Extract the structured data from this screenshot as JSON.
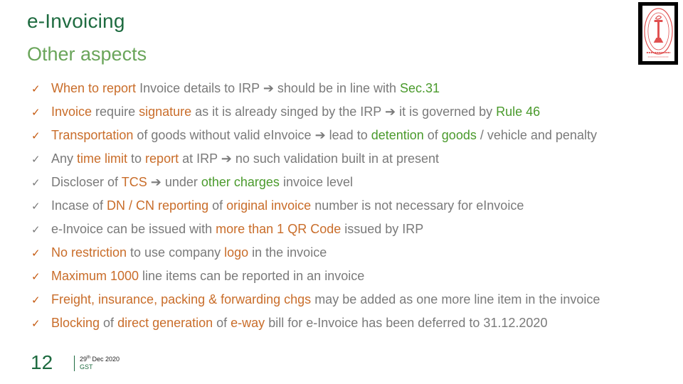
{
  "header": {
    "title": "e-Invoicing",
    "subtitle": "Other aspects"
  },
  "logo": {
    "icon": "institute-emblem-icon",
    "color": "#e05050"
  },
  "colors": {
    "title": "#1e6b40",
    "subtitle": "#6aa55a",
    "body_text": "#7a7a7a",
    "highlight_orange": "#c96d2a",
    "highlight_green": "#4a9a2c"
  },
  "bullets": [
    {
      "check": "o",
      "segments": [
        {
          "t": "When to report",
          "c": "o"
        },
        {
          "t": " Invoice details to IRP ",
          "c": "n"
        },
        {
          "t": "➔",
          "c": "n"
        },
        {
          "t": " should be in line with ",
          "c": "n"
        },
        {
          "t": "Sec.31",
          "c": "g"
        }
      ]
    },
    {
      "check": "o",
      "segments": [
        {
          "t": "Invoice",
          "c": "o"
        },
        {
          "t": " require ",
          "c": "n"
        },
        {
          "t": "signature",
          "c": "o"
        },
        {
          "t": " as it is already singed by the IRP ",
          "c": "n"
        },
        {
          "t": "➔",
          "c": "n"
        },
        {
          "t": " it is governed by ",
          "c": "n"
        },
        {
          "t": "Rule 46",
          "c": "g"
        }
      ]
    },
    {
      "check": "o",
      "segments": [
        {
          "t": "Transportation",
          "c": "o"
        },
        {
          "t": " of goods without valid eInvoice ",
          "c": "n"
        },
        {
          "t": "➔",
          "c": "n"
        },
        {
          "t": " lead to ",
          "c": "n"
        },
        {
          "t": "detention",
          "c": "g"
        },
        {
          "t": " of ",
          "c": "n"
        },
        {
          "t": "goods",
          "c": "g"
        },
        {
          "t": " / vehicle and penalty",
          "c": "n"
        }
      ]
    },
    {
      "check": "g",
      "segments": [
        {
          "t": "Any ",
          "c": "n"
        },
        {
          "t": "time limit",
          "c": "o"
        },
        {
          "t": " to ",
          "c": "n"
        },
        {
          "t": "report",
          "c": "o"
        },
        {
          "t": " at IRP ",
          "c": "n"
        },
        {
          "t": "➔",
          "c": "n"
        },
        {
          "t": " no such validation built in at present",
          "c": "n"
        }
      ]
    },
    {
      "check": "g",
      "segments": [
        {
          "t": "Discloser of ",
          "c": "n"
        },
        {
          "t": "TCS",
          "c": "o"
        },
        {
          "t": " ",
          "c": "n"
        },
        {
          "t": "➔",
          "c": "n"
        },
        {
          "t": " under ",
          "c": "n"
        },
        {
          "t": "other charges",
          "c": "g"
        },
        {
          "t": " invoice level",
          "c": "n"
        }
      ]
    },
    {
      "check": "g",
      "segments": [
        {
          "t": "Incase of ",
          "c": "n"
        },
        {
          "t": "DN / CN reporting",
          "c": "o"
        },
        {
          "t": " of ",
          "c": "n"
        },
        {
          "t": "original invoice",
          "c": "o"
        },
        {
          "t": " number is not necessary for eInvoice",
          "c": "n"
        }
      ]
    },
    {
      "check": "g",
      "segments": [
        {
          "t": "e-Invoice can be issued with ",
          "c": "n"
        },
        {
          "t": "more than 1 QR Code",
          "c": "o"
        },
        {
          "t": " issued by IRP",
          "c": "n"
        }
      ]
    },
    {
      "check": "o",
      "segments": [
        {
          "t": "No restriction",
          "c": "o"
        },
        {
          "t": " to use company ",
          "c": "n"
        },
        {
          "t": "logo",
          "c": "o"
        },
        {
          "t": " in the invoice",
          "c": "n"
        }
      ]
    },
    {
      "check": "o",
      "segments": [
        {
          "t": "Maximum 1000",
          "c": "o"
        },
        {
          "t": " line items can be reported in an invoice",
          "c": "n"
        }
      ]
    },
    {
      "check": "o",
      "segments": [
        {
          "t": "Freight, insurance, packing & forwarding chgs",
          "c": "o"
        },
        {
          "t": " may be added as one more line item in the invoice",
          "c": "n"
        }
      ]
    },
    {
      "check": "o",
      "segments": [
        {
          "t": "Blocking",
          "c": "o"
        },
        {
          "t": " of ",
          "c": "n"
        },
        {
          "t": "direct generation",
          "c": "o"
        },
        {
          "t": " of ",
          "c": "n"
        },
        {
          "t": "e-way",
          "c": "o"
        },
        {
          "t": " bill for e-Invoice has been deferred to 31.12.2020",
          "c": "n"
        }
      ]
    }
  ],
  "check_glyph": "✓",
  "footer": {
    "page_number": "12",
    "date_day": "29",
    "date_suffix": "th",
    "date_rest": " Dec 2020",
    "org": "GST"
  }
}
